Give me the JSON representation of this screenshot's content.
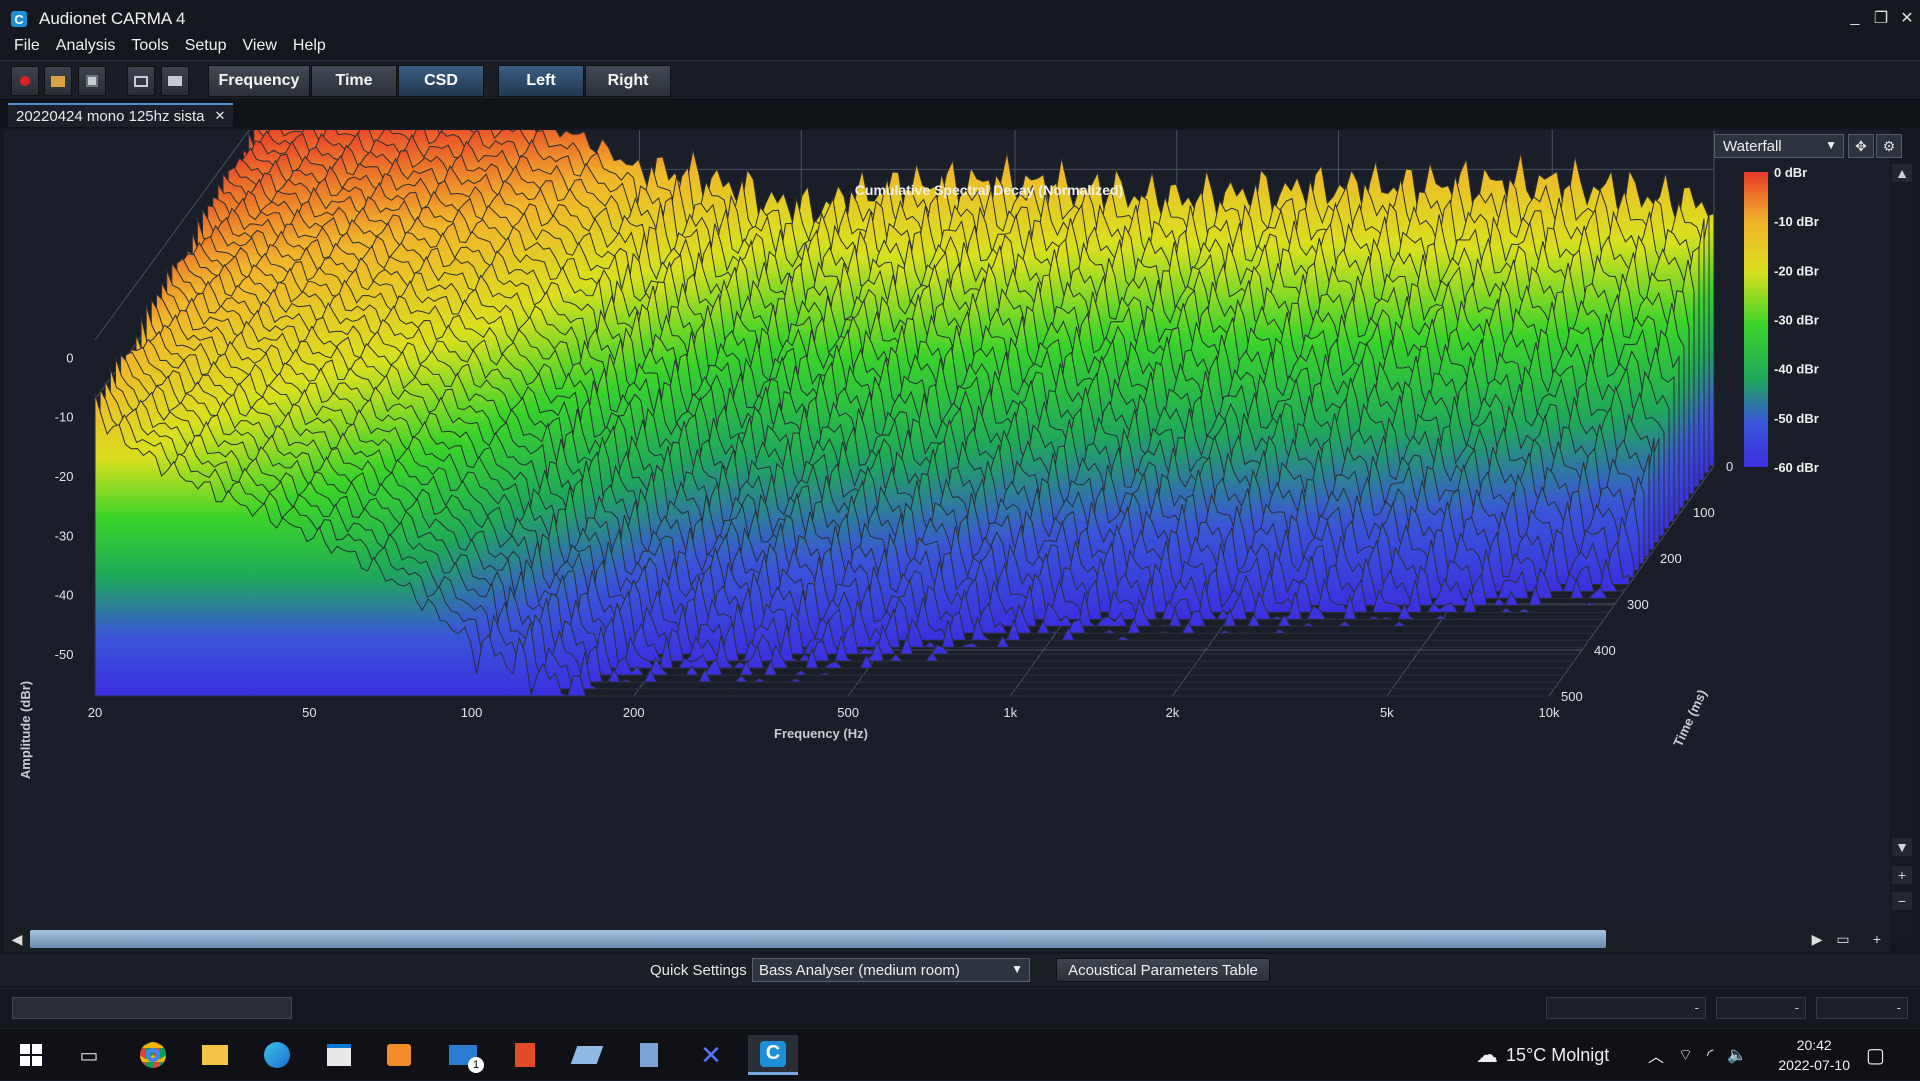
{
  "window": {
    "title": "Audionet CARMA 4",
    "min": "_",
    "restore": "❐",
    "close": "✕"
  },
  "menu": [
    "File",
    "Analysis",
    "Tools",
    "Setup",
    "View",
    "Help"
  ],
  "toolbar": {
    "icons": [
      "record-icon",
      "open-icon",
      "save-icon",
      "screenshot-icon",
      "print-icon"
    ],
    "views": [
      "Frequency",
      "Time",
      "CSD"
    ],
    "active_view": "CSD",
    "channels": [
      "Left",
      "Right"
    ],
    "active_channel": "Left"
  },
  "document_tab": {
    "label": "20220424 mono 125hz sista",
    "close": "✕"
  },
  "plot_controls": {
    "view_mode": "Waterfall",
    "move_icon": "move-icon",
    "settings_icon": "gear-icon"
  },
  "chart_data": {
    "type": "area",
    "subtype": "waterfall-3d",
    "title": "Cumulative Spectral Decay (Normalized)",
    "xlabel": "Frequency (Hz)",
    "ylabel": "Amplitude (dBr)",
    "zlabel": "Time (ms)",
    "x_scale": "log",
    "xlim": [
      20,
      10000
    ],
    "x_ticks": [
      "20",
      "50",
      "100",
      "200",
      "500",
      "1k",
      "2k",
      "5k",
      "10k"
    ],
    "ylim": [
      -60,
      0
    ],
    "y_ticks": [
      "0",
      "-10",
      "-20",
      "-30",
      "-40",
      "-50"
    ],
    "zlim": [
      0,
      500
    ],
    "z_ticks": [
      "0",
      "100",
      "200",
      "300",
      "400",
      "500"
    ],
    "colorbar": {
      "labels": [
        "0 dBr",
        "-10 dBr",
        "-20 dBr",
        "-30 dBr",
        "-40 dBr",
        "-50 dBr",
        "-60 dBr"
      ],
      "colors": [
        "#e83a2a",
        "#f1b52b",
        "#d9e01f",
        "#39d32a",
        "#1fa85a",
        "#3a55d8",
        "#3b2fe0"
      ]
    },
    "front_slice_envelope": {
      "x": [
        20,
        25,
        30,
        40,
        50,
        60,
        70,
        80,
        100,
        125,
        160,
        200,
        300,
        500,
        1000,
        2000,
        5000,
        10000
      ],
      "y": [
        0,
        0,
        0,
        0,
        -0.5,
        -1.5,
        -3,
        -5,
        -10,
        -11,
        -14,
        -17,
        -13,
        -12,
        -15,
        -13,
        -12,
        -16
      ]
    },
    "grid": true
  },
  "quick_settings": {
    "label": "Quick Settings",
    "value": "Bass Analyser (medium room)",
    "button": "Acoustical Parameters Table"
  },
  "status": {
    "fields": [
      "-",
      "-",
      "-"
    ]
  },
  "taskbar": {
    "apps": [
      "windows-start-icon",
      "task-view-icon",
      "chrome-icon",
      "file-explorer-icon",
      "edge-icon",
      "store-icon",
      "media-player-icon",
      "mail-icon",
      "office-icon",
      "network-tool-icon",
      "calculator-icon",
      "cross-app-icon",
      "carma-icon"
    ],
    "mail_badge": "1",
    "weather": "15°C  Molnigt",
    "time": "20:42",
    "date": "2022-07-10"
  }
}
